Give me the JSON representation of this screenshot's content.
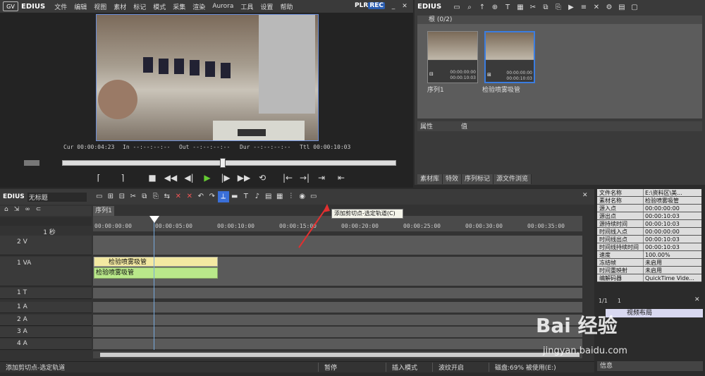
{
  "menubar": {
    "brand": "EDIUS",
    "items": [
      "文件",
      "编辑",
      "视图",
      "素材",
      "标记",
      "模式",
      "采集",
      "渲染",
      "Aurora",
      "工具",
      "设置",
      "帮助"
    ],
    "plr": "PLR",
    "rec": "REC"
  },
  "player": {
    "cur_label": "Cur",
    "cur": "00:00:04:23",
    "in_label": "In",
    "in": "--:--:--:--",
    "out_label": "Out",
    "out": "--:--:--:--",
    "dur_label": "Dur",
    "dur": "--:--:--:--",
    "ttl_label": "Ttl",
    "ttl": "00:00:10:03"
  },
  "bin": {
    "title": "EDIUS",
    "folder": "根 (0/2)",
    "clips": [
      {
        "name": "序列1",
        "tc1": "00:00:00:00",
        "tc2": "00:00:10:03"
      },
      {
        "name": "检验喷雾吸管",
        "tc1": "00:00:00:00",
        "tc2": "00:00:10:03"
      }
    ],
    "prop_cols": [
      "属性",
      "值"
    ],
    "tabs": [
      "素材库",
      "特效",
      "序列标记",
      "源文件浏览"
    ]
  },
  "timeline": {
    "brand": "EDIUS",
    "project": "无标题",
    "sequence": "序列1",
    "zoom": "1 秒",
    "ruler": [
      "00:00:00:00",
      "00:00:05:00",
      "00:00:10:00",
      "00:00:15:00",
      "00:00:20:00",
      "00:00:25:00",
      "00:00:30:00",
      "00:00:35:00"
    ],
    "tracks": [
      {
        "label": "2 V"
      },
      {
        "label": "1 VA"
      },
      {
        "label": "1 T"
      },
      {
        "label": "1 A"
      },
      {
        "label": "2 A"
      },
      {
        "label": "3 A"
      },
      {
        "label": "4 A"
      }
    ],
    "clip_video": "检验喷雾吸管",
    "clip_audio": "检验喷雾吸管",
    "tooltip": "添加剪切点-选定轨道(C)"
  },
  "status": {
    "msg": "添加剪切点-选定轨道",
    "state": "暂停",
    "mode": "插入模式",
    "ripple": "波纹开启",
    "disk": "磁盘:69% 被使用(E:)"
  },
  "info": {
    "rows": [
      [
        "文件名称",
        "E:\\资料区\\美..."
      ],
      [
        "素材名称",
        "检验喷雾吸管"
      ],
      [
        "源入点",
        "00:00:00:00"
      ],
      [
        "源出点",
        "00:00:10:03"
      ],
      [
        "源持续时间",
        "00:00:10:03"
      ],
      [
        "时间线入点",
        "00:00:00:00"
      ],
      [
        "时间线出点",
        "00:00:10:03"
      ],
      [
        "时间线持续时间",
        "00:00:10:03"
      ],
      [
        "速度",
        "100.00%"
      ],
      [
        "冻结帧",
        "未启用"
      ],
      [
        "时间重映射",
        "未启用"
      ],
      [
        "编解码器",
        "QuickTime Vide..."
      ]
    ],
    "layer_a": "1/1",
    "layer_b": "1",
    "layout_label": "视频布局",
    "footer": "信息"
  },
  "watermark": {
    "logo": "Bai 经验",
    "url": "jingyan.baidu.com"
  }
}
